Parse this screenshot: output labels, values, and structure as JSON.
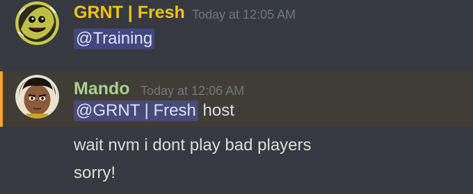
{
  "messages": [
    {
      "username": "GRNT | Fresh",
      "username_color": "#f1c40f",
      "timestamp": "Today at 12:05 AM",
      "avatar": "avatar-grnt",
      "content": {
        "mention": "@Training",
        "text": ""
      },
      "highlighted": false
    },
    {
      "username": "Mando",
      "username_color": "#a9d18e",
      "timestamp": "Today at 12:06 AM",
      "avatar": "avatar-mando",
      "content": {
        "mention": "@GRNT | Fresh",
        "text": " host"
      },
      "highlighted": true,
      "highlight_color": "#f9a62b"
    }
  ],
  "followups": [
    "wait nvm i dont play bad players",
    "sorry!"
  ]
}
